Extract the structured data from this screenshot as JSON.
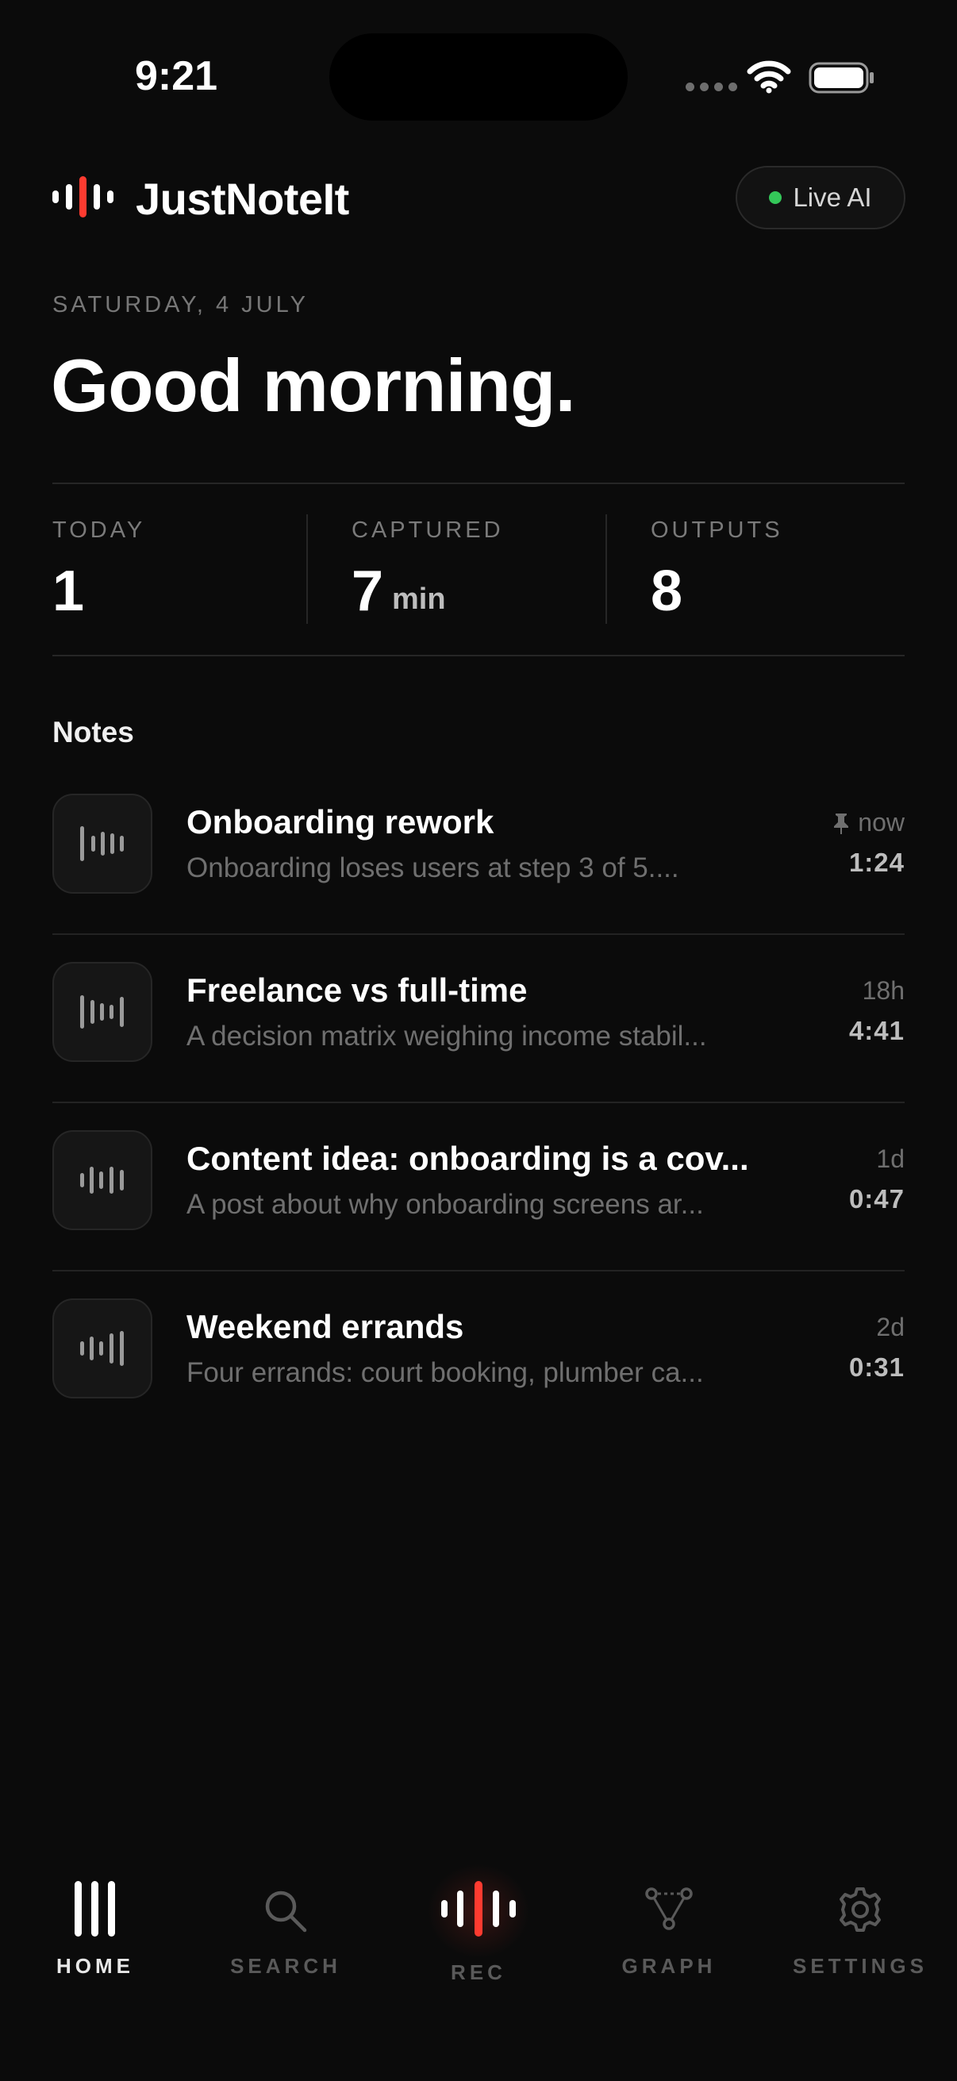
{
  "status_bar": {
    "time": "9:21"
  },
  "header": {
    "app_name": "JustNoteIt",
    "live_badge": "Live AI",
    "accent": "#ff3b30",
    "live_color": "#34c759"
  },
  "date": "SATURDAY, 4 JULY",
  "greeting": "Good morning.",
  "stats": [
    {
      "label": "TODAY",
      "value": "1",
      "unit": ""
    },
    {
      "label": "CAPTURED",
      "value": "7",
      "unit": "min"
    },
    {
      "label": "OUTPUTS",
      "value": "8",
      "unit": ""
    }
  ],
  "notes_heading": "Notes",
  "notes": [
    {
      "title": "Onboarding rework",
      "snippet": "Onboarding loses users at step 3 of 5....",
      "age": "now",
      "duration": "1:24",
      "pinned": true
    },
    {
      "title": "Freelance vs full-time",
      "snippet": "A decision matrix weighing income stabil...",
      "age": "18h",
      "duration": "4:41",
      "pinned": false
    },
    {
      "title": "Content idea: onboarding is a cov...",
      "snippet": "A post about why onboarding screens ar...",
      "age": "1d",
      "duration": "0:47",
      "pinned": false
    },
    {
      "title": "Weekend errands",
      "snippet": "Four errands: court booking, plumber ca...",
      "age": "2d",
      "duration": "0:31",
      "pinned": false
    }
  ],
  "tabs": [
    {
      "label": "HOME",
      "icon": "home-bars-icon",
      "active": true
    },
    {
      "label": "SEARCH",
      "icon": "search-icon",
      "active": false
    },
    {
      "label": "REC",
      "icon": "waveform-icon",
      "active": false
    },
    {
      "label": "GRAPH",
      "icon": "graph-icon",
      "active": false
    },
    {
      "label": "SETTINGS",
      "icon": "gear-icon",
      "active": false
    }
  ]
}
